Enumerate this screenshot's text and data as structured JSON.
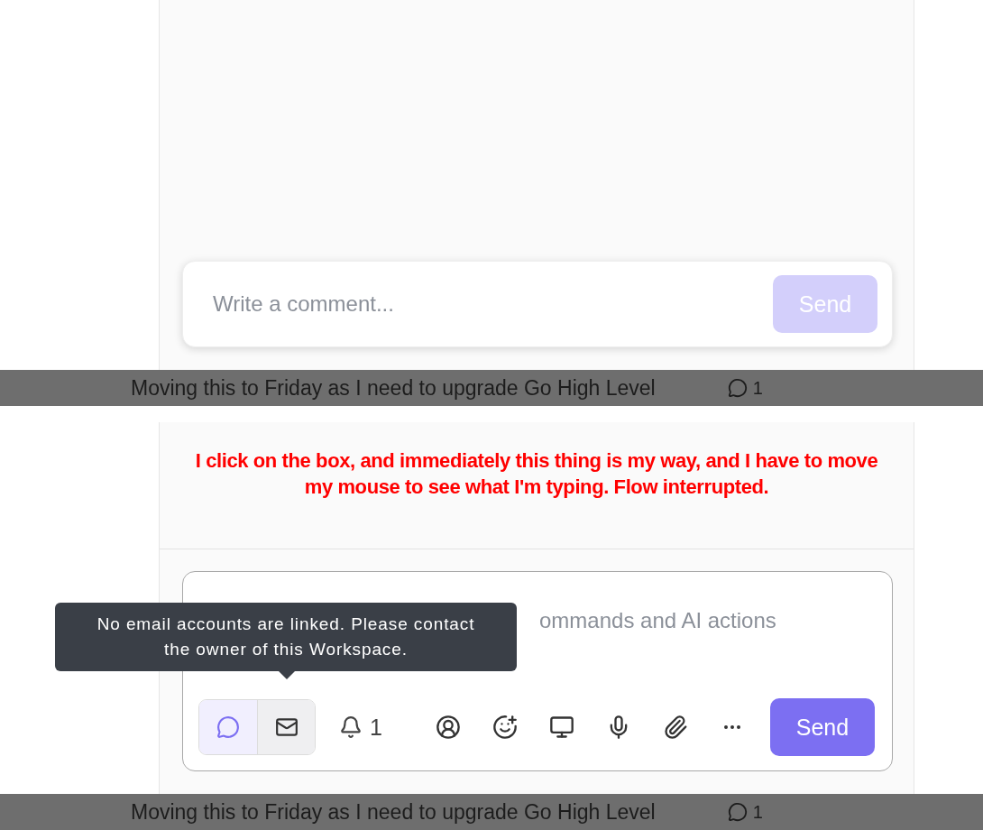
{
  "top_composer": {
    "placeholder": "Write a comment...",
    "send": {
      "label": "Send",
      "disabled": true
    }
  },
  "task_row_1": {
    "text": "Moving this to Friday as I need to upgrade Go High Level",
    "count": "1"
  },
  "annotation": "I click on the box, and immediately this thing is my way, and I have to move my mouse to see what I'm typing. Flow interrupted.",
  "composer": {
    "placeholder": "ommands and AI actions",
    "tooltip": "No email accounts are linked. Please contact the owner of this Workspace.",
    "modes": [
      {
        "kind": "comment",
        "selected": true
      },
      {
        "kind": "email",
        "selected": false
      }
    ],
    "notify_count": "1",
    "tools": [
      {
        "kind": "mention"
      },
      {
        "kind": "emoji"
      },
      {
        "kind": "screen"
      },
      {
        "kind": "voice"
      },
      {
        "kind": "attach"
      },
      {
        "kind": "more"
      }
    ],
    "send": {
      "label": "Send",
      "disabled": false
    }
  },
  "task_row_2": {
    "text": "Moving this to Friday as I need to upgrade Go High Level",
    "count": "1"
  }
}
